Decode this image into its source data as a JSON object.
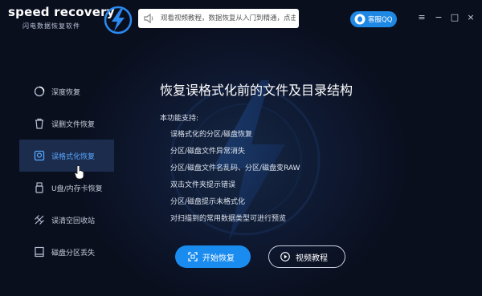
{
  "app": {
    "title": "speed recovery",
    "subtitle": "闪电数据恢复软件"
  },
  "notice": {
    "text": "观看视频教程，数据恢复从入门到精通，点击立即学习！"
  },
  "header": {
    "qq_label": "客服QQ",
    "controls": [
      "≡",
      "−",
      "□",
      "×"
    ]
  },
  "sidebar": {
    "items": [
      {
        "label": "深度恢复",
        "icon": "deep-scan-icon"
      },
      {
        "label": "误删文件恢复",
        "icon": "trash-icon"
      },
      {
        "label": "误格式化恢复",
        "icon": "disk-icon",
        "active": true
      },
      {
        "label": "U盘/内存卡恢复",
        "icon": "usb-icon"
      },
      {
        "label": "误清空回收站",
        "icon": "recycle-icon"
      },
      {
        "label": "磁盘分区丢失",
        "icon": "partition-icon"
      }
    ]
  },
  "main": {
    "title": "恢复误格式化前的文件及目录结构",
    "support_label": "本功能支持:",
    "features": [
      "误格式化的分区/磁盘恢复",
      "分区/磁盘文件异常消失",
      "分区/磁盘文件名乱码、分区/磁盘变RAW",
      "双击文件夹提示错误",
      "分区/磁盘提示未格式化",
      "对扫描到的常用数据类型可进行预览"
    ],
    "start_label": "开始恢复",
    "video_label": "视频教程"
  },
  "colors": {
    "accent": "#1a8cf0",
    "active_text": "#5aa8ff",
    "background": "#0a0f1e"
  }
}
